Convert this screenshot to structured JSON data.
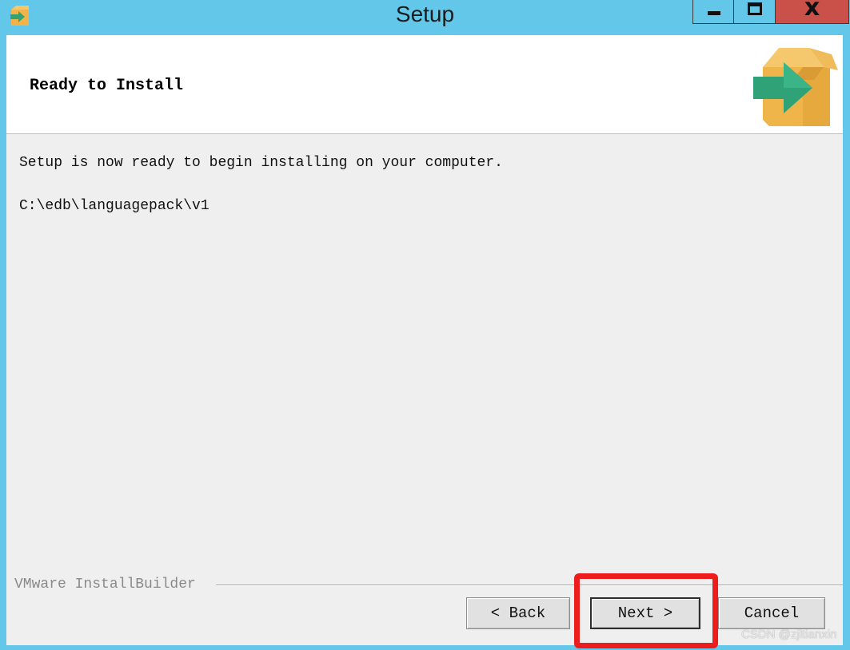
{
  "window": {
    "title": "Setup",
    "controls": {
      "minimize": "–",
      "maximize": "□",
      "close": "x"
    },
    "titlebar_color": "#63c7ea",
    "close_color": "#c9514a"
  },
  "header": {
    "title": "Ready to Install",
    "icon": "installer-box-arrow-icon"
  },
  "body": {
    "message": "Setup is now ready to begin installing on your computer.",
    "path": "C:\\edb\\languagepack\\v1"
  },
  "footer": {
    "brand": "VMware InstallBuilder",
    "buttons": {
      "back": "< Back",
      "next": "Next >",
      "cancel": "Cancel"
    },
    "highlight_color": "#ee1d1d"
  },
  "watermark": "CSDN @zjltianxin"
}
